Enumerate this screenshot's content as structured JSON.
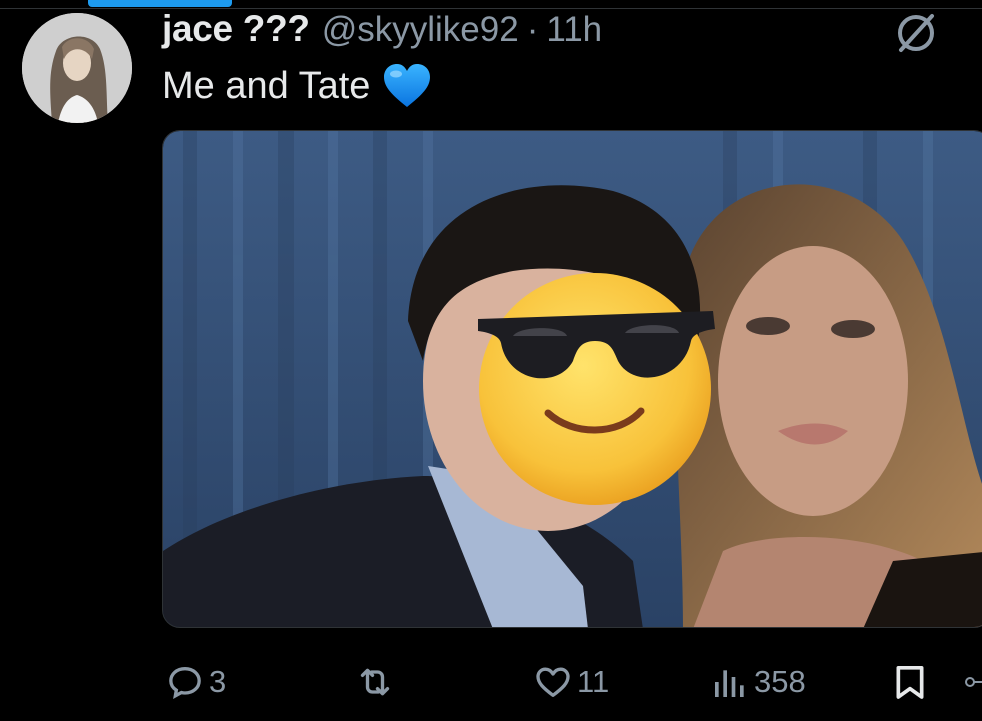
{
  "tweet": {
    "display_name": "jace ???",
    "handle": "@skyylike92",
    "separator": "·",
    "time": "11h",
    "text": "Me and Tate",
    "text_emoji": "blue-heart-emoji",
    "media_description_icon": "photo-with-sunglasses-emoji"
  },
  "actions": {
    "reply_count": "3",
    "retweet_count": "",
    "like_count": "11",
    "views_count": "358"
  },
  "icons": {
    "grok": "grok-icon",
    "reply": "reply-icon",
    "retweet": "retweet-icon",
    "like": "heart-icon",
    "views": "analytics-icon",
    "bookmark": "bookmark-icon",
    "share": "share-icon"
  },
  "colors": {
    "accent": "#1d9bf0",
    "muted": "#8b98a5",
    "text": "#e7e9ea",
    "background": "#000000"
  }
}
